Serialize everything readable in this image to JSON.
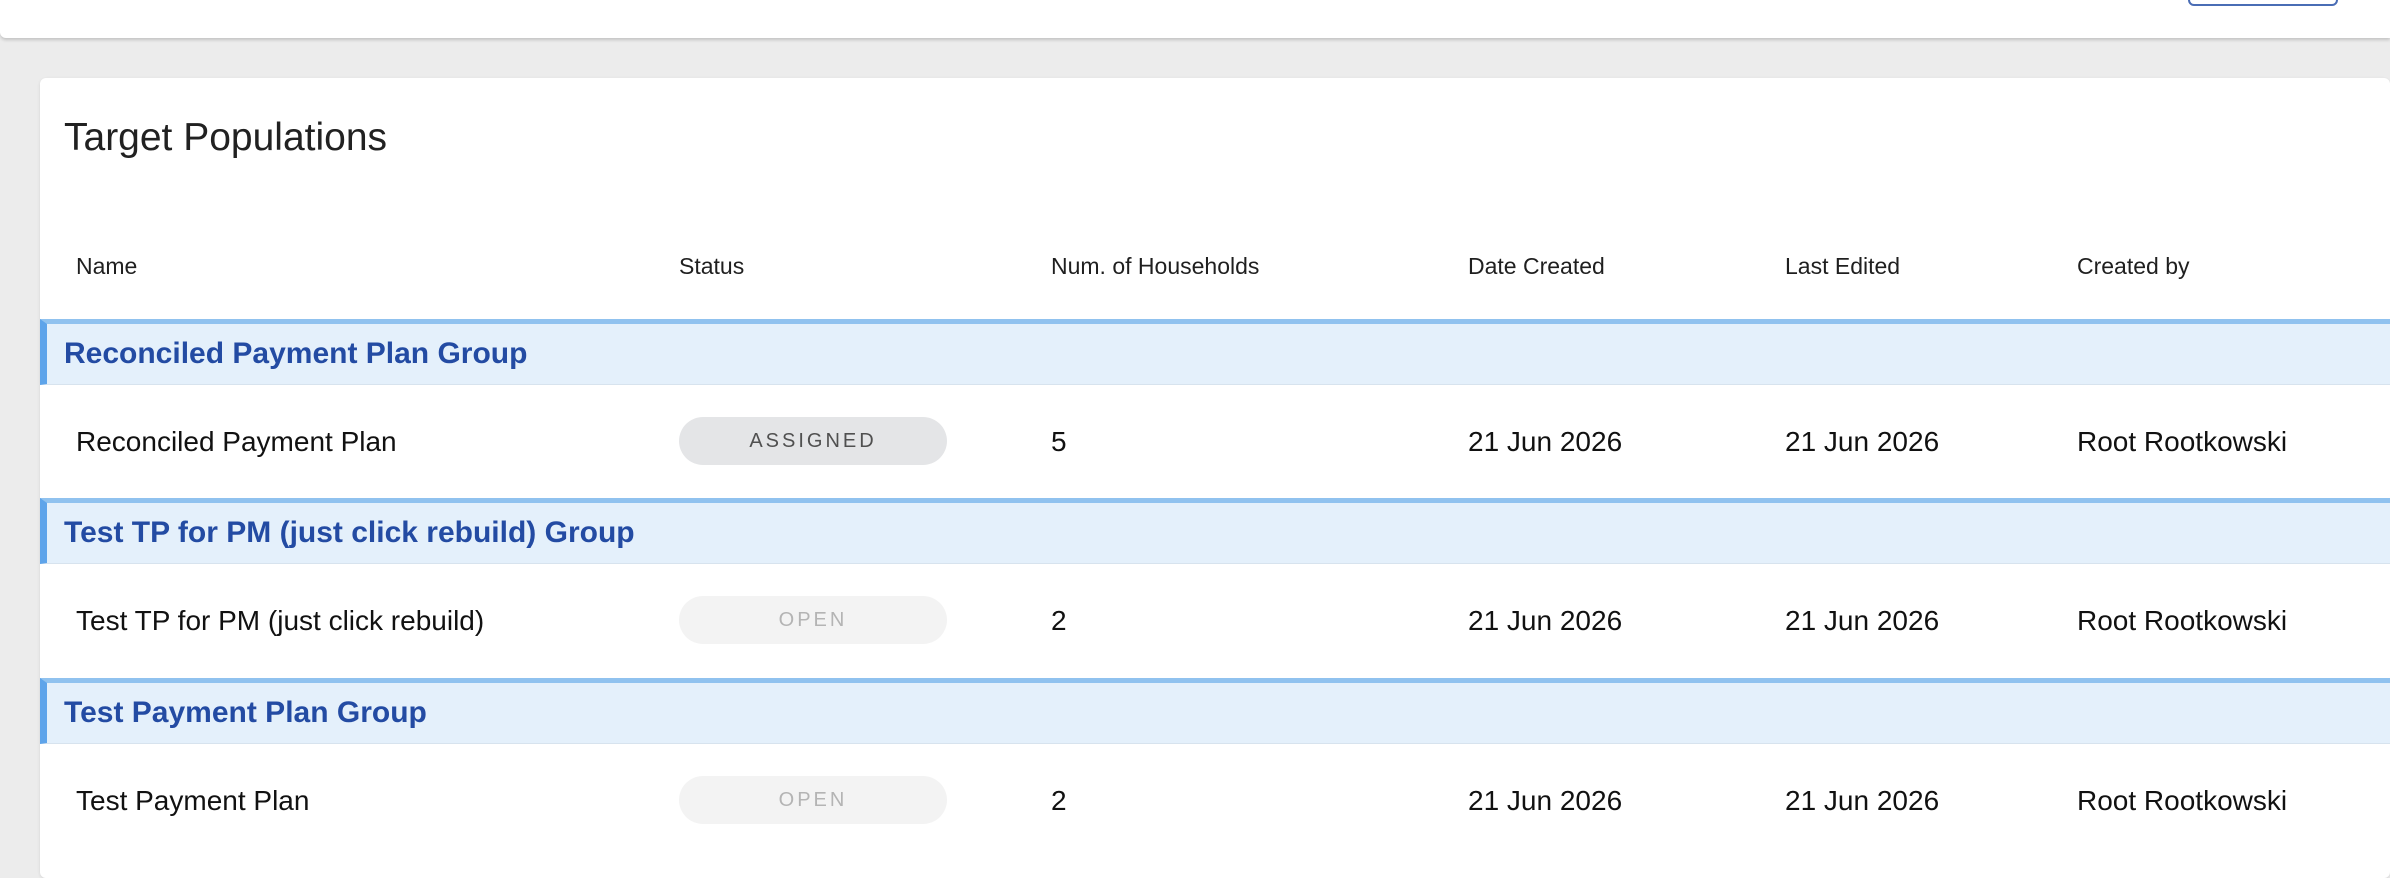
{
  "page": {
    "title": "Target Populations"
  },
  "table": {
    "columns": [
      "Name",
      "Status",
      "Num. of Households",
      "Date Created",
      "Last Edited",
      "Created by"
    ],
    "groups": [
      {
        "label": "Reconciled Payment Plan Group",
        "row": {
          "name": "Reconciled Payment Plan",
          "status": "ASSIGNED",
          "households": "5",
          "date_created": "21 Jun 2026",
          "last_edited": "21 Jun 2026",
          "created_by": "Root Rootkowski"
        }
      },
      {
        "label": "Test TP for PM (just click rebuild) Group",
        "row": {
          "name": "Test TP for PM (just click rebuild)",
          "status": "OPEN",
          "households": "2",
          "date_created": "21 Jun 2026",
          "last_edited": "21 Jun 2026",
          "created_by": "Root Rootkowski"
        }
      },
      {
        "label": "Test Payment Plan Group",
        "row": {
          "name": "Test Payment Plan",
          "status": "OPEN",
          "households": "2",
          "date_created": "21 Jun 2026",
          "last_edited": "21 Jun 2026",
          "created_by": "Root Rootkowski"
        }
      }
    ]
  },
  "colors": {
    "group_background": "#e4f0fb",
    "group_text": "#234ba3",
    "group_accent": "#5ea4ea",
    "assigned_chip": "#e4e5e7",
    "open_chip": "#f3f3f3"
  }
}
